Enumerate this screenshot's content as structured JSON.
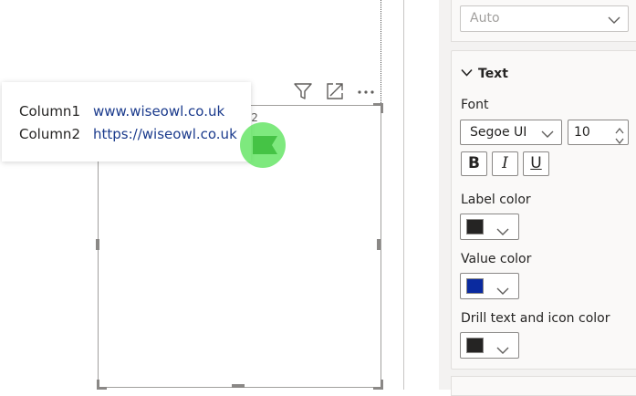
{
  "visual": {
    "title_peek": "mn2"
  },
  "tooltip": {
    "rows": [
      {
        "label": "Column1",
        "value": "www.wiseowl.co.uk"
      },
      {
        "label": "Column2",
        "value": "https://wiseowl.co.uk"
      }
    ]
  },
  "format_pane": {
    "top_dropdown": {
      "value": "Auto"
    },
    "text_section": {
      "title": "Text",
      "font_label": "Font",
      "font_family": "Segoe UI",
      "font_size": "10",
      "bold": "B",
      "italic": "I",
      "underline": "U",
      "label_color": {
        "label": "Label color",
        "hex": "#252423"
      },
      "value_color": {
        "label": "Value color",
        "hex": "#0a2a9f"
      },
      "drill_color": {
        "label": "Drill text and icon color",
        "hex": "#252423"
      }
    }
  },
  "icons": [
    "filter-icon",
    "focus-mode-icon",
    "more-options-icon",
    "chevron-down-icon",
    "chevron-up-icon"
  ]
}
